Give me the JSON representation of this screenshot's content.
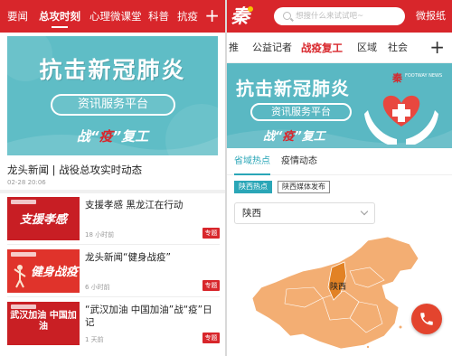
{
  "left": {
    "tabs": [
      {
        "label": "要闻"
      },
      {
        "label": "总攻时刻",
        "active": true
      },
      {
        "label": "心理微课堂"
      },
      {
        "label": "科普"
      },
      {
        "label": "抗疫"
      }
    ],
    "plus": "+",
    "banner": {
      "title": "抗击新冠肺炎",
      "pill": "资讯服务平台",
      "slogan_pre": "战“",
      "slogan_mid": "疫",
      "slogan_post": "”复工"
    },
    "headline": "龙头新闻 | 战役总攻实时动态",
    "date": "02-28 20:06",
    "news": [
      {
        "thumb": "支援孝感",
        "title": "支援孝感 黑龙江在行动",
        "time": "18 小时前",
        "tag": "专题"
      },
      {
        "thumb": "健身战疫",
        "title": "龙头新闻“健身战疫”",
        "time": "6 小时前",
        "tag": "专题"
      },
      {
        "thumb": "武汉加油 中国加油",
        "title": "“武汉加油 中国加油”战“疫”日记",
        "time": "1 天前",
        "tag": "专题"
      }
    ]
  },
  "right": {
    "logo": "秦",
    "search_placeholder": "想搜什么来试试吧~",
    "newspaper": "微报纸",
    "tabs": [
      {
        "label": "推"
      },
      {
        "label": "公益记者"
      },
      {
        "label": "战疫复工",
        "active": true
      },
      {
        "label": "区域"
      },
      {
        "label": "社会"
      }
    ],
    "plus": "+",
    "banner": {
      "title": "抗击新冠肺炎",
      "pill": "资讯服务平台",
      "slogan_pre": "战“",
      "slogan_mid": "疫",
      "slogan_post": "”复工",
      "brand": "秦",
      "brand_sub": "FOOTWAY NEWS"
    },
    "subtabs": [
      {
        "label": "省域热点",
        "active": true
      },
      {
        "label": "疫情动态"
      }
    ],
    "chips": [
      {
        "label": "陕西热点",
        "active": true
      },
      {
        "label": "陕西媒体发布"
      }
    ],
    "province_select": "陕西",
    "map_label": "陕西",
    "colors": {
      "brand_red": "#d8262b",
      "teal": "#2aa6b7",
      "map_orange": "#f3ae73",
      "highlight": "#e28225"
    }
  }
}
